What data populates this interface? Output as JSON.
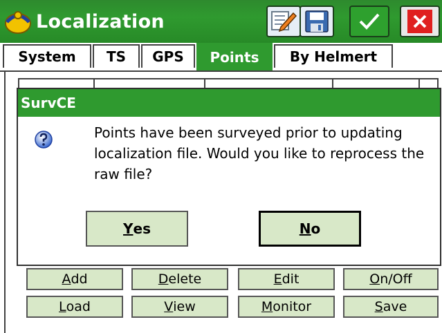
{
  "window": {
    "title": "Localization",
    "buttons": [
      "edit-icon",
      "save-icon",
      "checkmark-icon",
      "close-icon"
    ],
    "accent": "#2f9a2f"
  },
  "tabs": [
    "System",
    "TS",
    "GPS",
    "Points",
    "By Helmert"
  ],
  "active_tab": "Points",
  "bottom_buttons": [
    {
      "label": "Add",
      "underline": "A",
      "rest": "dd"
    },
    {
      "label": "Delete",
      "underline": "D",
      "rest": "elete"
    },
    {
      "label": "Edit",
      "underline": "E",
      "rest": "dit"
    },
    {
      "label": "On/Off",
      "underline": "O",
      "rest": "n/Off"
    },
    {
      "label": "Load",
      "underline": "L",
      "rest": "oad"
    },
    {
      "label": "View",
      "underline": "V",
      "rest": "iew"
    },
    {
      "label": "Monitor",
      "underline": "M",
      "rest": "onitor"
    },
    {
      "label": "Save",
      "underline": "S",
      "rest": "ave"
    }
  ],
  "dialog": {
    "title": "SurvCE",
    "icon": "question-icon",
    "message": "Points have been surveyed prior to updating localization file. Would you like to reprocess the raw file?",
    "yes": {
      "underline": "Y",
      "rest": "es"
    },
    "no": {
      "underline": "N",
      "rest": "o"
    }
  }
}
